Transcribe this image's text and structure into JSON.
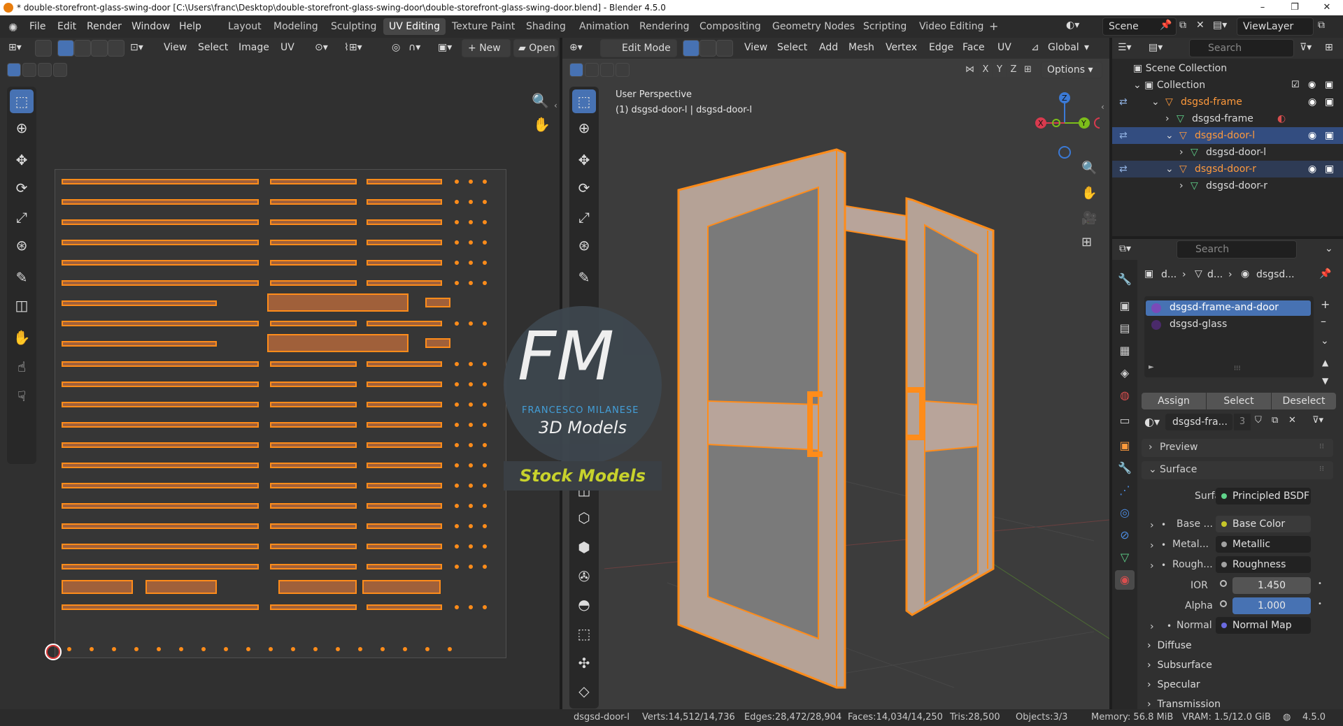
{
  "window": {
    "title": "* double-storefront-glass-swing-door [C:\\Users\\franc\\Desktop\\double-storefront-glass-swing-door\\double-storefront-glass-swing-door.blend] - Blender 4.5.0",
    "min": "–",
    "max": "❐",
    "close": "✕"
  },
  "menus": [
    "File",
    "Edit",
    "Render",
    "Window",
    "Help"
  ],
  "workspaces": [
    "Layout",
    "Modeling",
    "Sculpting",
    "UV Editing",
    "Texture Paint",
    "Shading",
    "Animation",
    "Rendering",
    "Compositing",
    "Geometry Nodes",
    "Scripting",
    "Video Editing"
  ],
  "active_workspace": "UV Editing",
  "scene": {
    "name": "Scene",
    "viewlayer": "ViewLayer"
  },
  "uv_editor": {
    "menus": [
      "View",
      "Select",
      "Image",
      "UV"
    ],
    "new_label": "New",
    "open_label": "Open"
  },
  "viewport": {
    "mode": "Edit Mode",
    "menus": [
      "View",
      "Select",
      "Add",
      "Mesh",
      "Vertex",
      "Edge",
      "Face",
      "UV"
    ],
    "orientation": "Global",
    "options": "Options",
    "axis_x": "X",
    "axis_y": "Y",
    "axis_z": "Z",
    "perspective": "User Perspective",
    "object_info": "(1) dsgsd-door-l | dsgsd-door-l"
  },
  "watermark": {
    "logo": "FM",
    "name": "FRANCESCO MILANESE",
    "sub": "3D Models",
    "banner": "Stock Models"
  },
  "outliner": {
    "search": "Search",
    "scene_collection": "Scene Collection",
    "collection": "Collection",
    "items": [
      {
        "label": "dsgsd-frame",
        "selected": false
      },
      {
        "label": "dsgsd-frame",
        "selected": false
      },
      {
        "label": "dsgsd-door-l",
        "selected": true
      },
      {
        "label": "dsgsd-door-l",
        "selected": false
      },
      {
        "label": "dsgsd-door-r",
        "selected": false
      },
      {
        "label": "dsgsd-door-r",
        "selected": false
      }
    ]
  },
  "properties": {
    "search": "Search",
    "breadcrumb": [
      "d...",
      "d...",
      "dsgsd..."
    ],
    "materials": [
      "dsgsd-frame-and-door",
      "dsgsd-glass"
    ],
    "assign": "Assign",
    "select": "Select",
    "deselect": "Deselect",
    "material_name": "dsgsd-fra...",
    "users": "3",
    "preview": "Preview",
    "surface_section": "Surface",
    "surface_label": "Surface",
    "surface_value": "Principled BSDF",
    "rows": [
      {
        "label": "Base ...",
        "value": "Base Color",
        "dot": "#c7c729"
      },
      {
        "label": "Metal...",
        "value": "Metallic",
        "dot": "#a1a1a1"
      },
      {
        "label": "Rough...",
        "value": "Roughness",
        "dot": "#a1a1a1"
      }
    ],
    "ior_label": "IOR",
    "ior_value": "1.450",
    "alpha_label": "Alpha",
    "alpha_value": "1.000",
    "normal_label": "Normal",
    "normal_value": "Normal Map",
    "sections": [
      "Diffuse",
      "Subsurface",
      "Specular",
      "Transmission"
    ]
  },
  "status": {
    "object": "dsgsd-door-l",
    "verts": "Verts:14,512/14,736",
    "edges": "Edges:28,472/28,904",
    "faces": "Faces:14,034/14,250",
    "tris": "Tris:28,500",
    "objects": "Objects:3/3",
    "memory": "Memory: 56.8 MiB",
    "vram": "VRAM: 1.5/12.0 GiB",
    "version": "4.5.0"
  },
  "colors": {
    "accent": "#4772b3",
    "selection": "#ff8c1a",
    "outliner_sel": "#334d80"
  }
}
